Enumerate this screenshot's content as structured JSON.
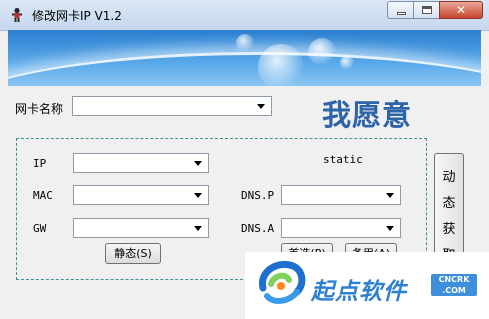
{
  "window": {
    "title": "修改网卡IP V1.2",
    "controls": {
      "minimize": "",
      "maximize": "",
      "close": "✕"
    }
  },
  "form": {
    "adapter_label": "网卡名称",
    "adapter_value": "",
    "slogan": "我愿意",
    "mode_label": "static",
    "fields": {
      "ip_label": "IP",
      "mac_label": "MAC",
      "gw_label": "GW",
      "dns_p_label": "DNS.P",
      "dns_a_label": "DNS.A",
      "ip_value": "",
      "mac_value": "",
      "gw_value": "",
      "dns_p_value": "",
      "dns_a_value": ""
    },
    "buttons": {
      "static": "静态(S)",
      "primary": "首选(P)",
      "backup": "备用(A)",
      "dynamic_chars": [
        "动",
        "态",
        "获",
        "取"
      ]
    }
  },
  "watermark": {
    "text": "起点软件",
    "badge_line1": "CNCRK",
    "badge_line2": ".COM"
  },
  "colors": {
    "slogan": "#2d63a8",
    "group_border": "#3f8f95",
    "watermark_blue": "#2f80d0"
  },
  "icons": {
    "app": "person-figure-icon",
    "combo_arrow": "chevron-down-icon",
    "watermark_logo": "swirl-logo-icon"
  }
}
